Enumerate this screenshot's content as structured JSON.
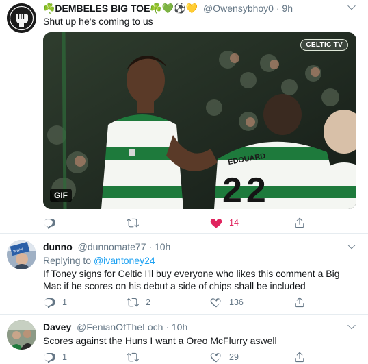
{
  "tweets": [
    {
      "name": "☘️DEMBELES BIG TOE☘️💚⚽️💛",
      "handle": "@Owensybhoy0",
      "separator": "·",
      "time": "9h",
      "text": "Shut up he's coming to us",
      "media": {
        "badge": "GIF",
        "watermark": "CELTIC TV",
        "jersey_name": "EDOUARD"
      },
      "actions": {
        "reply": "",
        "retweet": "",
        "like": "14",
        "liked": true
      }
    },
    {
      "name": "dunno",
      "handle": "@dunnomate77",
      "separator": "·",
      "time": "10h",
      "replying_label": "Replying to",
      "replying_handle": "@ivantoney24",
      "text": "If Toney signs for Celtic I'll buy everyone who likes this comment a Big Mac if he scores on his debut a side of chips shall be included",
      "actions": {
        "reply": "1",
        "retweet": "2",
        "like": "136"
      }
    },
    {
      "name": "Davey",
      "handle": "@FenianOfTheLoch",
      "separator": "·",
      "time": "10h",
      "text": "Scores against the Huns I want a Oreo McFlurry aswell",
      "actions": {
        "reply": "1",
        "retweet": "",
        "like": "29"
      }
    }
  ],
  "colors": {
    "accent": "#1da1f2",
    "like": "#e0245e",
    "muted": "#657786",
    "celtic_green": "#1e7a3c"
  }
}
